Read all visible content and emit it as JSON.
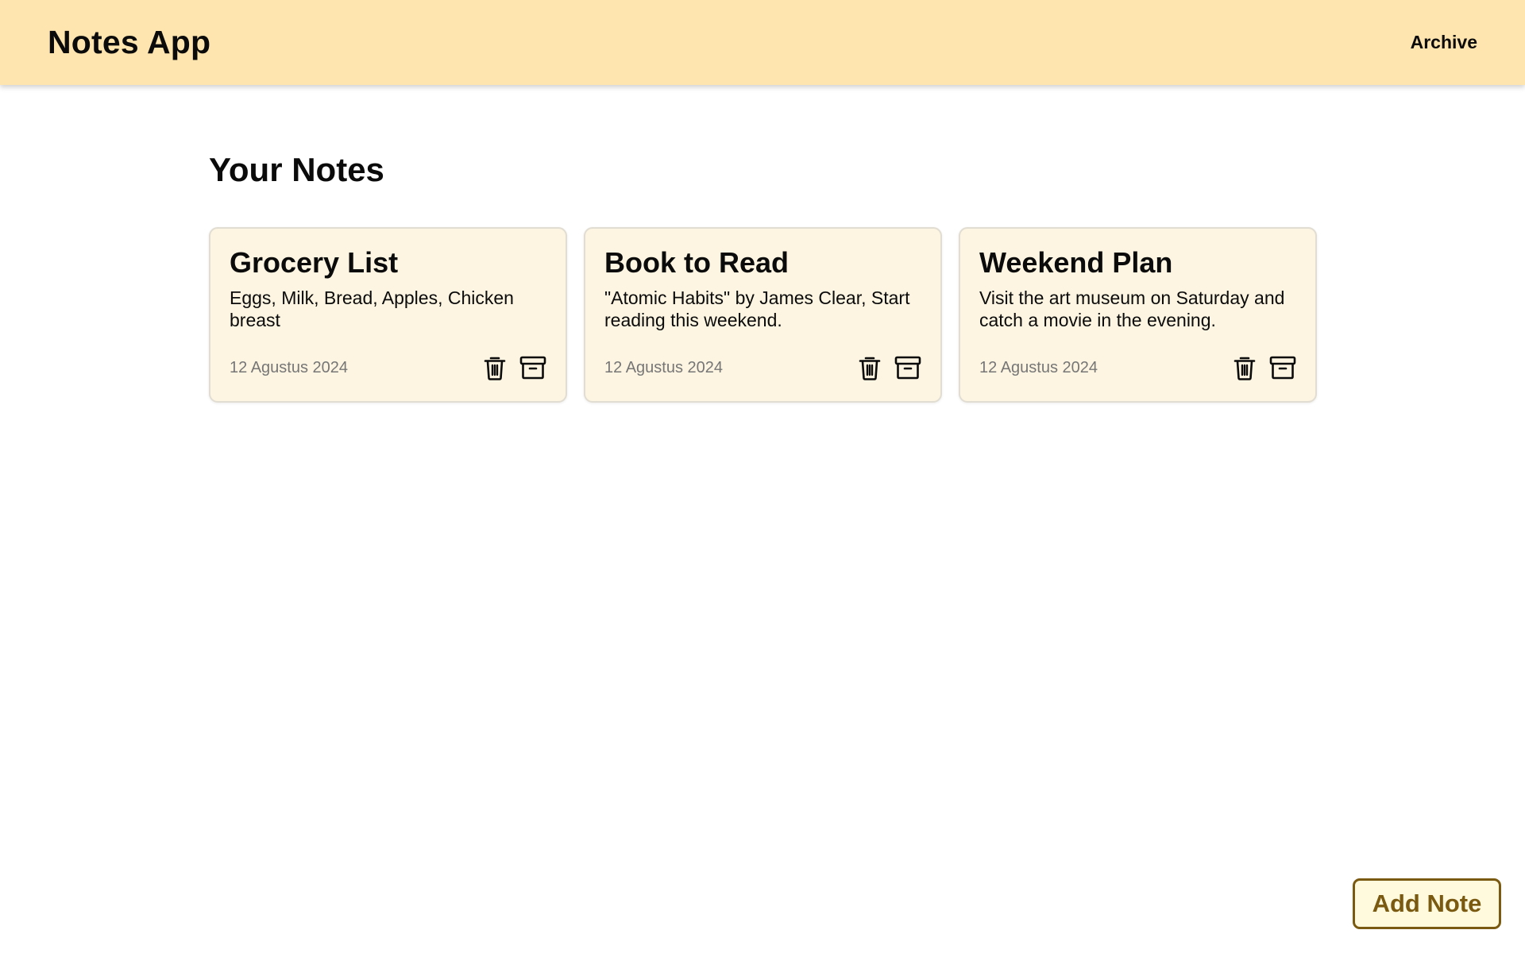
{
  "app": {
    "title": "Notes App"
  },
  "nav": {
    "archive_label": "Archive"
  },
  "main": {
    "heading": "Your Notes"
  },
  "notes": [
    {
      "title": "Grocery List",
      "body": "Eggs, Milk, Bread, Apples, Chicken breast",
      "date": "12 Agustus 2024"
    },
    {
      "title": "Book to Read",
      "body": "\"Atomic Habits\" by James Clear, Start reading this weekend.",
      "date": "12 Agustus 2024"
    },
    {
      "title": "Weekend Plan",
      "body": "Visit the art museum on Saturday and catch a movie in the evening.",
      "date": "12 Agustus 2024"
    }
  ],
  "icons": {
    "delete": "trash-icon",
    "archive": "archive-box-icon"
  },
  "add_button": {
    "label": "Add Note"
  },
  "colors": {
    "navbar_bg": "#fee4ae",
    "card_bg": "#fdf5e2",
    "add_button_accent": "#7a5a10",
    "add_button_bg": "#fff9dd"
  }
}
